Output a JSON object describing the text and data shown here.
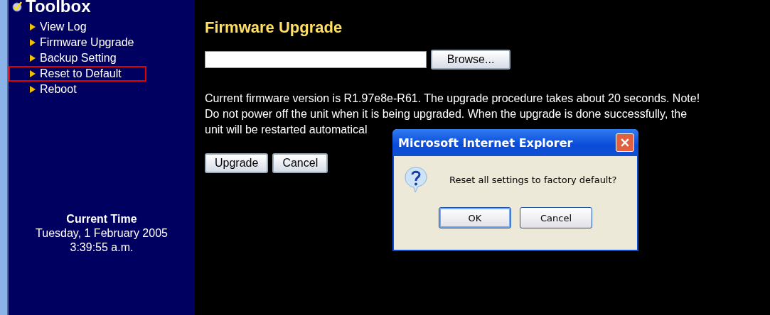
{
  "sidebar": {
    "title": "Toolbox",
    "items": [
      {
        "label": "View Log",
        "selected": false
      },
      {
        "label": "Firmware Upgrade",
        "selected": false
      },
      {
        "label": "Backup Setting",
        "selected": false
      },
      {
        "label": "Reset to Default",
        "selected": true
      },
      {
        "label": "Reboot",
        "selected": false
      }
    ],
    "clock": {
      "heading": "Current Time",
      "date": "Tuesday, 1 February 2005",
      "time": "3:39:55 a.m."
    }
  },
  "main": {
    "title": "Firmware Upgrade",
    "browse_button": "Browse...",
    "notice_lines": [
      "Current firmware version is R1.97e8e-R61. The upgrade procedure takes about 20 seconds. Note!",
      "Do not power off the unit when it is being upgraded. When the upgrade is done successfully, the",
      "unit will be restarted automatical"
    ],
    "buttons": [
      "Upgrade",
      "Cancel"
    ]
  },
  "dialog": {
    "title": "Microsoft Internet Explorer",
    "message": "Reset all settings to factory default?",
    "buttons": [
      "OK",
      "Cancel"
    ]
  }
}
